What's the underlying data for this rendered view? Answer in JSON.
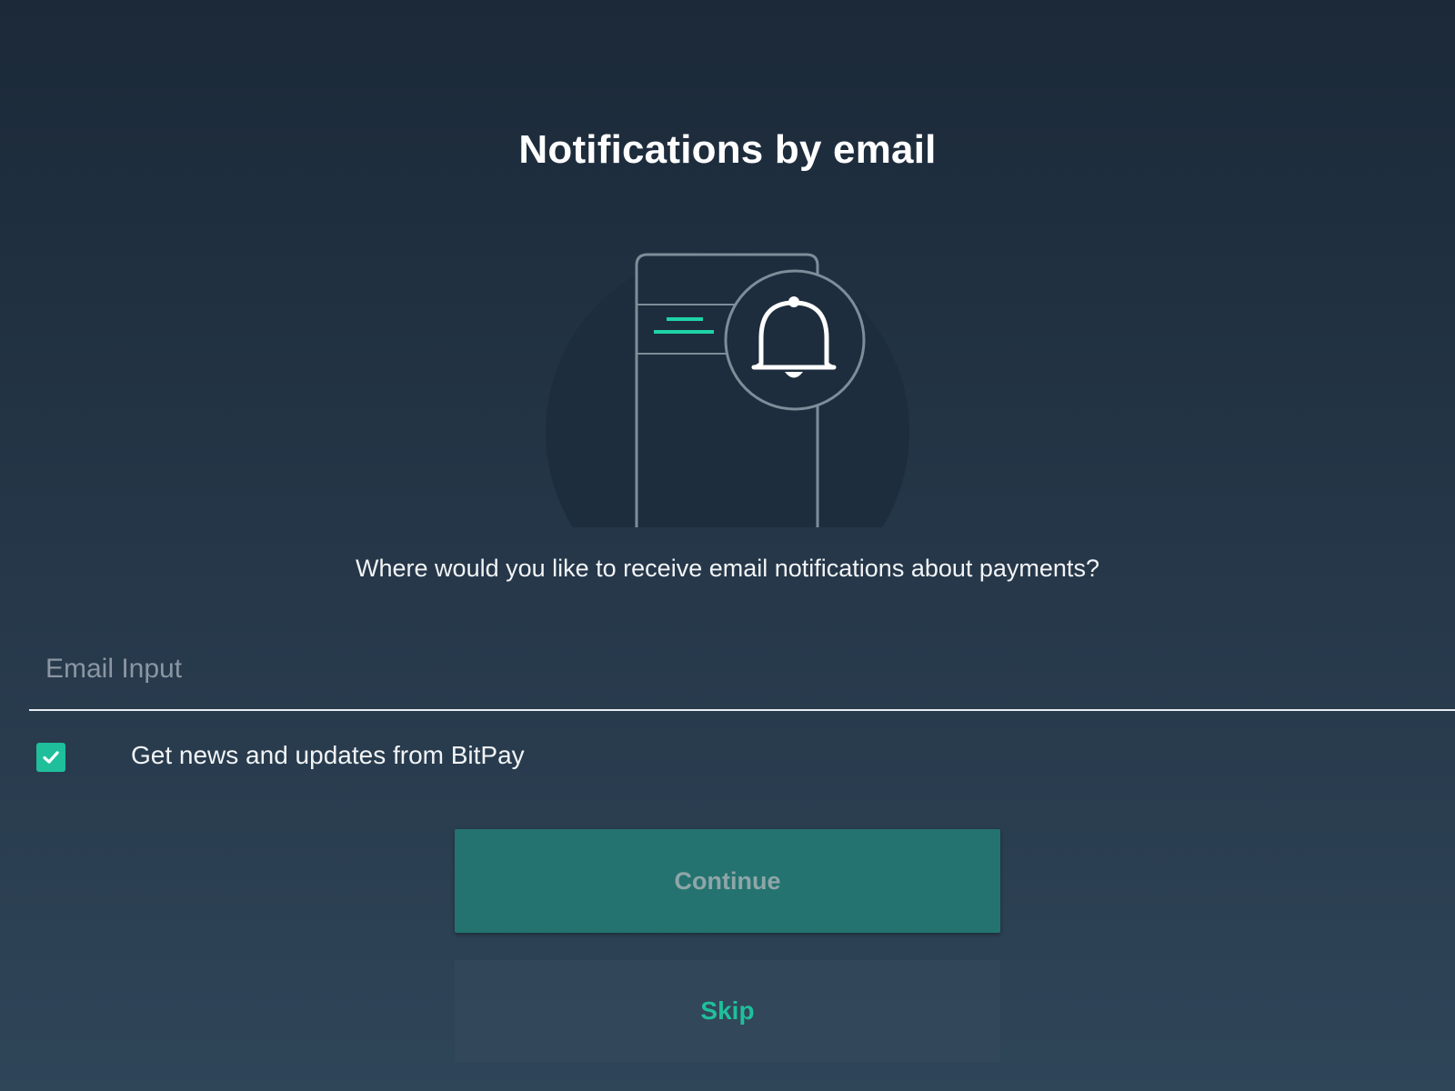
{
  "page": {
    "title": "Notifications by email",
    "subtitle": "Where would you like to receive email notifications about payments?"
  },
  "email": {
    "placeholder": "Email Input",
    "value": ""
  },
  "news_opt_in": {
    "label": "Get news and updates from BitPay",
    "checked": true
  },
  "actions": {
    "continue_label": "Continue",
    "skip_label": "Skip"
  },
  "illustration": {
    "icons": [
      "phone-icon",
      "bell-icon"
    ]
  },
  "colors": {
    "accent": "#1fbf9c",
    "continue_bg": "#247370",
    "background_top": "#1b2938",
    "background_bottom": "#2f4558"
  }
}
